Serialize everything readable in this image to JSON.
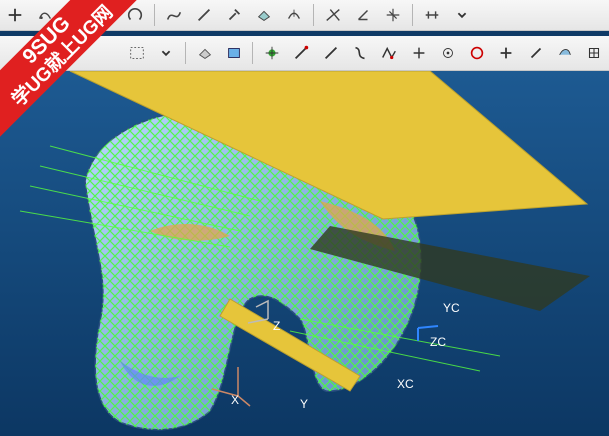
{
  "watermark": {
    "line1": "9SUG",
    "line2": "学UG就上UG网"
  },
  "toolbar_row1": [
    "plus-icon",
    "sketch-icon",
    "dropdown-icon",
    "curve-icon",
    "arc-icon",
    "spline-icon",
    "line-icon",
    "wrench-icon",
    "surface-icon",
    "curve-edit-icon",
    "trim-icon",
    "angle-icon",
    "axis-icon",
    "measure-icon",
    "dropdown-icon"
  ],
  "toolbar_row2": [
    "selection-box-icon",
    "dropdown-icon",
    "shaded-icon",
    "box-icon",
    "point-icon",
    "line-icon",
    "line-icon",
    "spline-icon",
    "curve-icon",
    "axis-icon",
    "point-snap-icon",
    "circle-icon",
    "plus-icon",
    "slash-icon",
    "surface-icon",
    "grid-icon"
  ],
  "axes": {
    "x": "X",
    "y": "Y",
    "z": "Z",
    "xc": "XC",
    "yc": "YC",
    "zc": "ZC"
  }
}
